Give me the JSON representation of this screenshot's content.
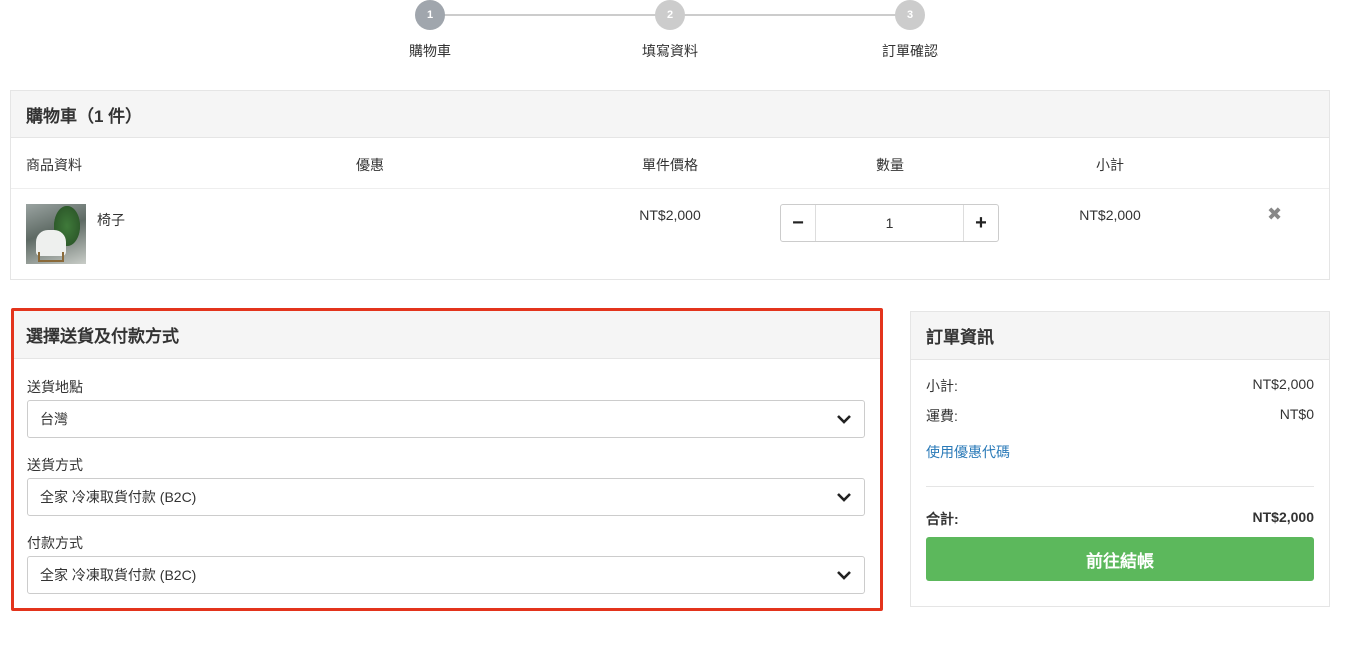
{
  "steps": [
    {
      "number": "1",
      "label": "購物車"
    },
    {
      "number": "2",
      "label": "填寫資料"
    },
    {
      "number": "3",
      "label": "訂單確認"
    }
  ],
  "cart": {
    "title": "購物車（1 件）",
    "columns": {
      "product": "商品資料",
      "discount": "優惠",
      "unit_price": "單件價格",
      "quantity": "數量",
      "subtotal": "小計"
    },
    "items": [
      {
        "name": "椅子",
        "unit_price": "NT$2,000",
        "quantity": "1",
        "subtotal": "NT$2,000",
        "qty_minus": "−",
        "qty_plus": "+",
        "remove": "✖"
      }
    ]
  },
  "shipping": {
    "title": "選擇送貨及付款方式",
    "location_label": "送貨地點",
    "location_value": "台灣",
    "method_label": "送貨方式",
    "method_value": "全家 冷凍取貨付款 (B2C)",
    "payment_label": "付款方式",
    "payment_value": "全家 冷凍取貨付款 (B2C)"
  },
  "summary": {
    "title": "訂單資訊",
    "subtotal_label": "小計:",
    "subtotal_value": "NT$2,000",
    "shipping_label": "運費:",
    "shipping_value": "NT$0",
    "coupon_link": "使用優惠代碼",
    "total_label": "合計:",
    "total_value": "NT$2,000",
    "checkout_button": "前往結帳"
  },
  "colors": {
    "highlight_border": "#e3341c",
    "checkout_green": "#5cb85c",
    "link_blue": "#2a7ab8",
    "step_active": "#a0a6ad",
    "step_inactive": "#cccccc"
  }
}
